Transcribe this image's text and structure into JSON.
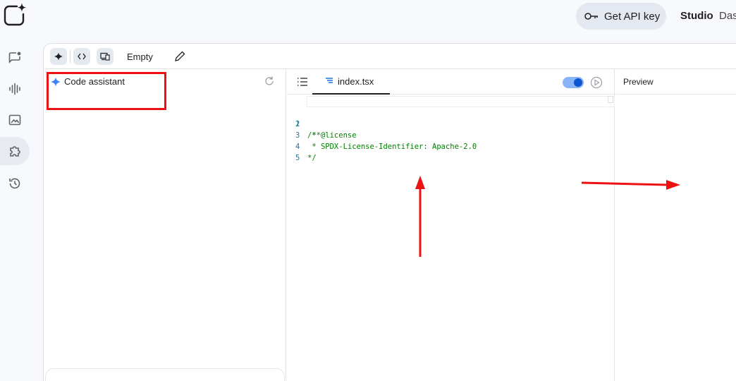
{
  "header": {
    "api_key_label": "Get API key",
    "studio_label": "Studio",
    "dashboard_label": "Das"
  },
  "toolbar": {
    "title": "Empty"
  },
  "assistant": {
    "title": "Code assistant"
  },
  "editor": {
    "file_tab": "index.tsx",
    "lines": [
      {
        "num": "1",
        "text": "/**"
      },
      {
        "num": "2",
        "text": " * @license"
      },
      {
        "num": "3",
        "text": " * SPDX-License-Identifier: Apache-2.0"
      },
      {
        "num": "4",
        "text": "*/"
      },
      {
        "num": "5",
        "text": ""
      }
    ]
  },
  "preview": {
    "title": "Preview"
  },
  "colors": {
    "annotation_red": "#ee1111",
    "toggle_on": "#0b57d0"
  }
}
